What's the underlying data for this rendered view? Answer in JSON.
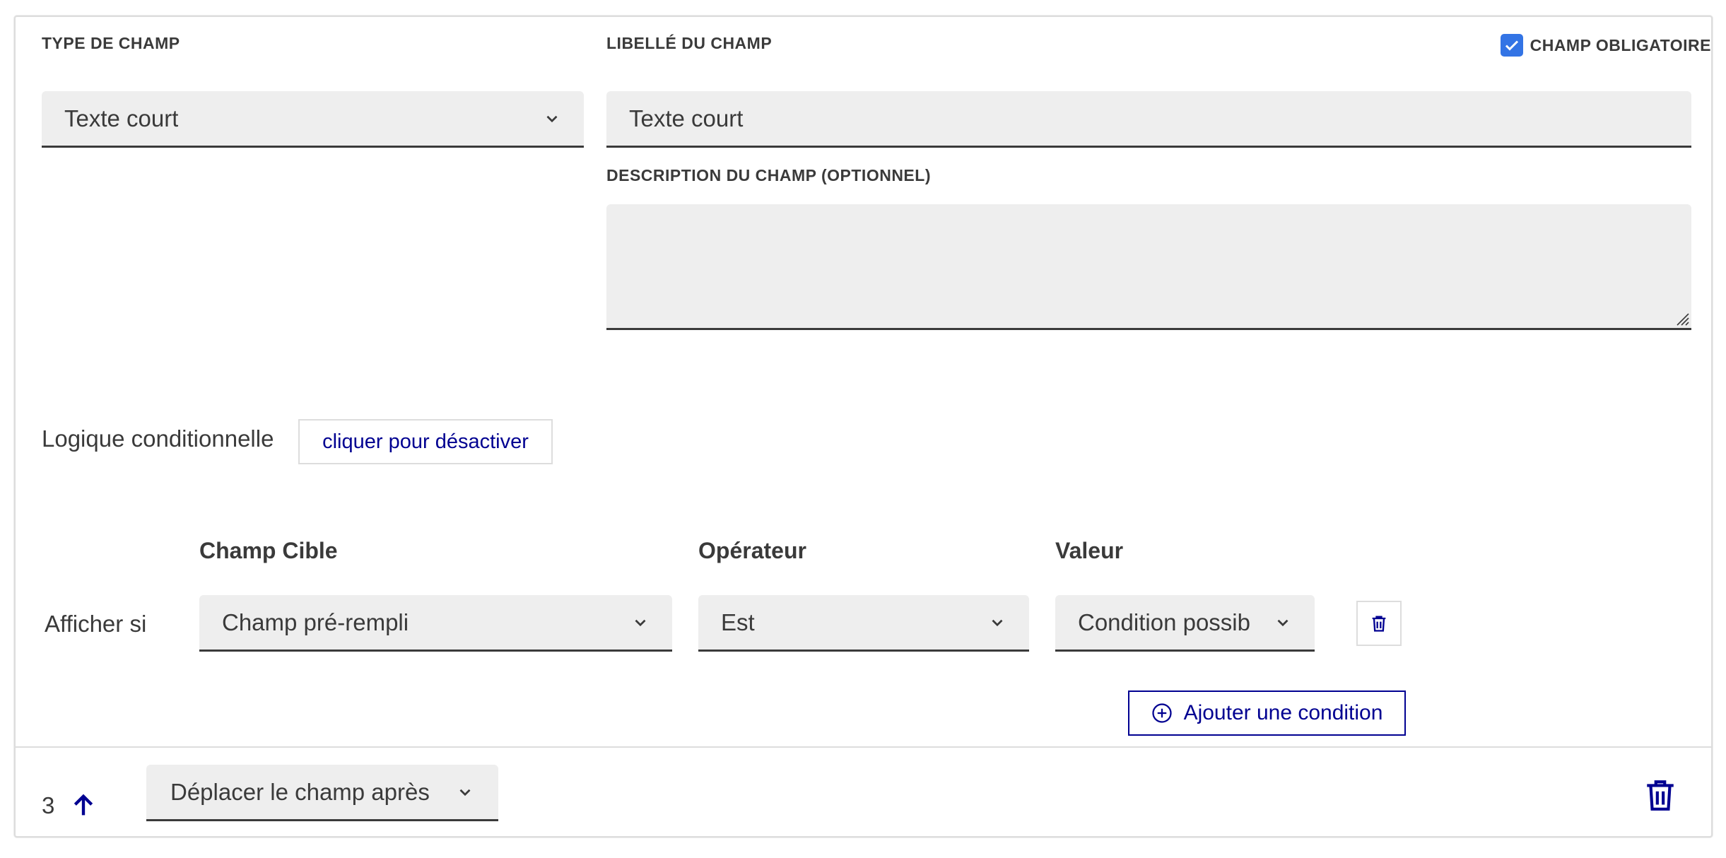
{
  "field": {
    "type_label": "TYPE DE CHAMP",
    "type_value": "Texte court",
    "name_label": "LIBELLÉ DU CHAMP",
    "name_value": "Texte court",
    "required_label": "CHAMP OBLIGATOIRE",
    "required_checked": true,
    "description_label": "DESCRIPTION DU CHAMP (OPTIONNEL)",
    "description_value": ""
  },
  "conditional": {
    "label": "Logique conditionnelle",
    "toggle_button": "cliquer pour désactiver",
    "headers": {
      "target": "Champ Cible",
      "operator": "Opérateur",
      "value": "Valeur"
    },
    "row_label": "Afficher si",
    "rows": [
      {
        "target": "Champ pré-rempli",
        "operator": "Est",
        "value": "Condition possib"
      }
    ],
    "add_button": "Ajouter une condition"
  },
  "footer": {
    "position": "3",
    "move_select": "Déplacer le champ après"
  },
  "colors": {
    "primary": "#000091",
    "checkbox": "#3374e5",
    "input_bg": "#eeeeee",
    "text": "#3a3a3a"
  },
  "icons": [
    "chevron-down-icon",
    "check-icon",
    "trash-icon",
    "plus-circle-icon",
    "arrow-up-icon",
    "resize-handle-icon"
  ]
}
